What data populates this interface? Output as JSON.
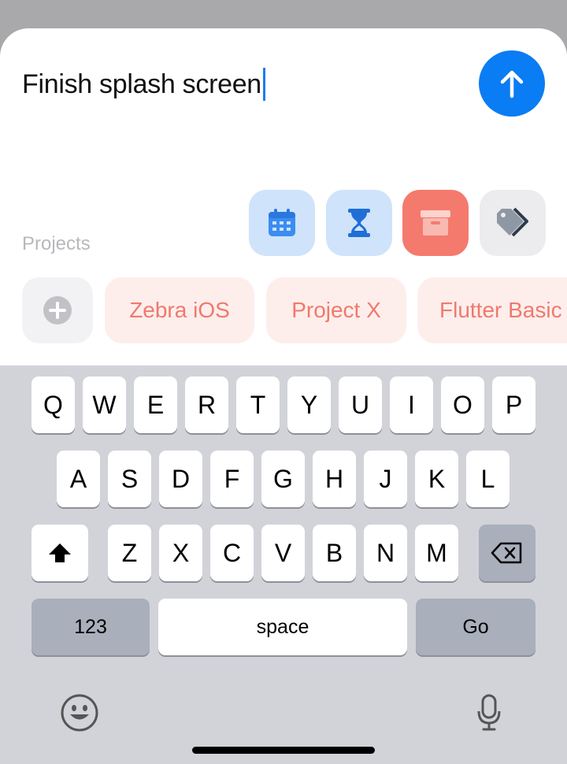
{
  "task": {
    "title": "Finish splash screen"
  },
  "send_button": {
    "icon": "arrow-up-icon",
    "color": "#0a7cf4"
  },
  "toolbar": {
    "projects_label": "Projects",
    "buttons": [
      {
        "name": "due-date",
        "icon": "calendar-icon",
        "color": "#cfe3fb"
      },
      {
        "name": "duration",
        "icon": "hourglass-icon",
        "color": "#cfe3fb"
      },
      {
        "name": "archive",
        "icon": "archive-box-icon",
        "color": "#f47a6d"
      },
      {
        "name": "tags",
        "icon": "tag-icon",
        "color": "#ececee"
      }
    ]
  },
  "projects": {
    "add_icon": "plus-circle-icon",
    "items": [
      "Zebra iOS",
      "Project X",
      "Flutter Basic"
    ],
    "chip_text_color": "#ef7a6c",
    "chip_bg_color": "#fdeeec"
  },
  "keyboard": {
    "rows": [
      [
        "Q",
        "W",
        "E",
        "R",
        "T",
        "Y",
        "U",
        "I",
        "O",
        "P"
      ],
      [
        "A",
        "S",
        "D",
        "F",
        "G",
        "H",
        "J",
        "K",
        "L"
      ],
      [
        "Z",
        "X",
        "C",
        "V",
        "B",
        "N",
        "M"
      ]
    ],
    "shift_icon": "shift-icon",
    "delete_icon": "backspace-icon",
    "numbers_label": "123",
    "space_label": "space",
    "go_label": "Go",
    "emoji_icon": "emoji-icon",
    "mic_icon": "microphone-icon"
  }
}
